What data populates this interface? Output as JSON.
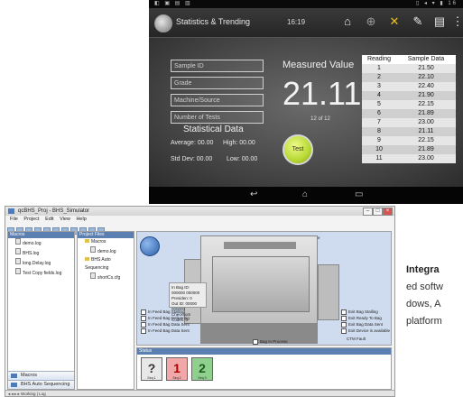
{
  "tablet": {
    "status_left": "◧ ▣ ▤ ▥",
    "status_right": "▯ ◂ ▾ ▮ 16",
    "title": "Statistics & Trending",
    "time": "16:19",
    "toolbar_icons": [
      "home-icon",
      "target-icon",
      "tools-icon",
      "wrench-icon",
      "print-icon",
      "menu-icon"
    ],
    "fields": [
      "Sample ID",
      "Grade",
      "Machine/Source",
      "Number of Tests"
    ],
    "measured_label": "Measured Value",
    "measured_value": "21.11",
    "count": "12 of 12",
    "test_button": "Test",
    "stats_title": "Statistical Data",
    "average": "Average: 00.00",
    "high": "High: 00.00",
    "std_dev": "Std Dev: 00.00",
    "low": "Low: 00.00",
    "table": {
      "headers": [
        "Reading",
        "Sample Data"
      ],
      "rows": [
        [
          "1",
          "21.50"
        ],
        [
          "2",
          "22.10"
        ],
        [
          "3",
          "22.40"
        ],
        [
          "4",
          "21.90"
        ],
        [
          "5",
          "22.15"
        ],
        [
          "6",
          "21.89"
        ],
        [
          "7",
          "23.00"
        ],
        [
          "8",
          "21.11"
        ],
        [
          "9",
          "22.15"
        ],
        [
          "10",
          "21.89"
        ],
        [
          "11",
          "23.00"
        ]
      ]
    }
  },
  "desktop": {
    "title": "qcBHS_Proj - BHS_Simulator",
    "menu": [
      "File",
      "Project",
      "Edit",
      "View",
      "Help"
    ],
    "tree_title": "Macros",
    "tree_items": [
      "demo.log",
      "BHS.log",
      "long.Delay.log",
      "Test Copy fields.log"
    ],
    "tree2_title": "Project Files",
    "tree2_items": [
      "Macros",
      "demo.log",
      "BHS Auto Sequencing",
      "shortCs.cfg"
    ],
    "nav_items": [
      "Macros",
      "BHS Auto Sequencing"
    ],
    "stage_checks": [
      "BoardBHS Active",
      "CTB Active"
    ],
    "info_lines": [
      "In Bag ID: 000000 000000",
      "Presiden: 0",
      "Out ID: 00000 000000",
      "Checksum Codes: 0"
    ],
    "left_checks": [
      "In Feed Bag Stalling",
      "In Feed Bag Delivering",
      "In Feed Bag Data Sent",
      "In Feed Bag Data Sent"
    ],
    "right_checks": [
      "Exit Bag Stalling",
      "Exit Ready To Bag",
      "Exit Bag Data Sent",
      "Exit Device is available"
    ],
    "right_label": "CTM Fault",
    "bag_label": "Bag In Process",
    "bottom_title": "Status",
    "cards": [
      {
        "symbol": "?",
        "label": "Seq 1"
      },
      {
        "symbol": "1",
        "label": "Seq 2"
      },
      {
        "symbol": "2",
        "label": "Seq 3"
      }
    ],
    "status_text": "◂ ◂ ▸ ▸  Working  |  Log"
  },
  "side_text": {
    "line1": "Integra",
    "line2": "ed softw",
    "line3": "dows, A",
    "line4": "platform"
  }
}
